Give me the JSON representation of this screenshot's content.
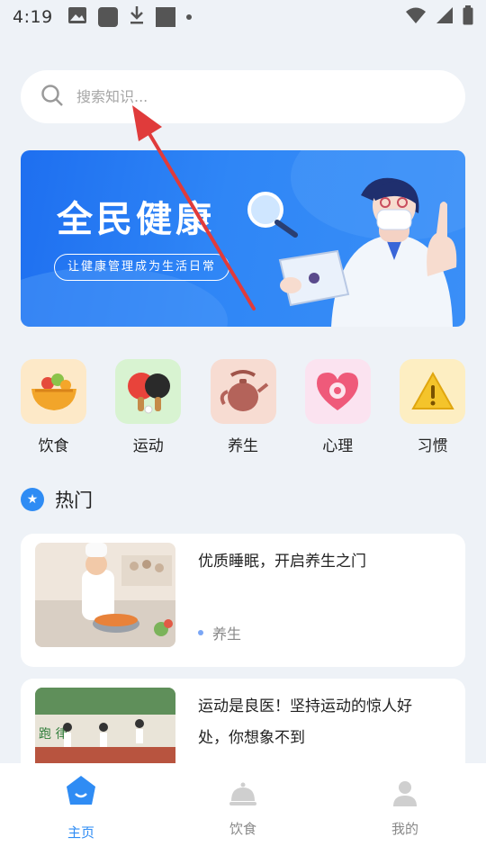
{
  "status_bar": {
    "time": "4:19"
  },
  "search": {
    "placeholder": "搜索知识..."
  },
  "banner": {
    "title": "全民健康",
    "subtitle": "让健康管理成为生活日常"
  },
  "categories": [
    {
      "label": "饮食",
      "icon": "food-bowl-icon",
      "bg": "#fde9c8"
    },
    {
      "label": "运动",
      "icon": "ping-pong-icon",
      "bg": "#d8f3d1"
    },
    {
      "label": "养生",
      "icon": "teapot-icon",
      "bg": "#f7dcd2"
    },
    {
      "label": "心理",
      "icon": "heart-icon",
      "bg": "#fbe3f0"
    },
    {
      "label": "习惯",
      "icon": "warning-icon",
      "bg": "#fdeec2"
    }
  ],
  "hot_section": {
    "title": "热门"
  },
  "articles": [
    {
      "title": "优质睡眠，开启养生之门",
      "tag": "养生"
    },
    {
      "title": "运动是良医！坚持运动的惊人好处，你想象不到",
      "tag": ""
    }
  ],
  "tabs": [
    {
      "label": "主页",
      "icon": "home-icon",
      "active": true
    },
    {
      "label": "饮食",
      "icon": "dish-icon",
      "active": false
    },
    {
      "label": "我的",
      "icon": "user-icon",
      "active": false
    }
  ],
  "colors": {
    "accent": "#2f8cf4",
    "background": "#eef2f7",
    "banner": "#2f86f6"
  }
}
